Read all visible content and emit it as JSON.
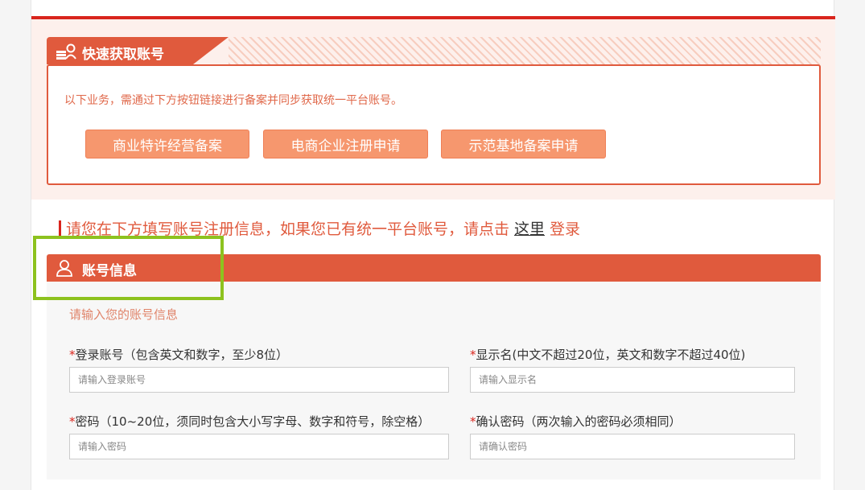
{
  "quick": {
    "title": "快速获取账号",
    "description": "以下业务，需通过下方按钮链接进行备案并同步获取统一平台账号。",
    "buttons": [
      "商业特许经营备案",
      "电商企业注册申请",
      "示范基地备案申请"
    ]
  },
  "notice": {
    "before": "请您在下方填写账号注册信息，如果您已有统一平台账号，请点击",
    "link": "这里",
    "after": "登录"
  },
  "account": {
    "title": "账号信息",
    "hint": "请输入您的账号信息",
    "fields": [
      {
        "required": "*",
        "label": "登录账号（包含英文和数字，至少8位）",
        "placeholder": "请输入登录账号"
      },
      {
        "required": "*",
        "label": "显示名(中文不超过20位，英文和数字不超过40位)",
        "placeholder": "请输入显示名"
      },
      {
        "required": "*",
        "label": "密码（10~20位，须同时包含大小写字母、数字和符号，除空格）",
        "placeholder": "请输入密码"
      },
      {
        "required": "*",
        "label": "确认密码（两次输入的密码必须相同）",
        "placeholder": "请确认密码"
      }
    ]
  },
  "colors": {
    "accent": "#e05a3d",
    "button": "#f6976e",
    "highlight": "#8dc21f"
  }
}
